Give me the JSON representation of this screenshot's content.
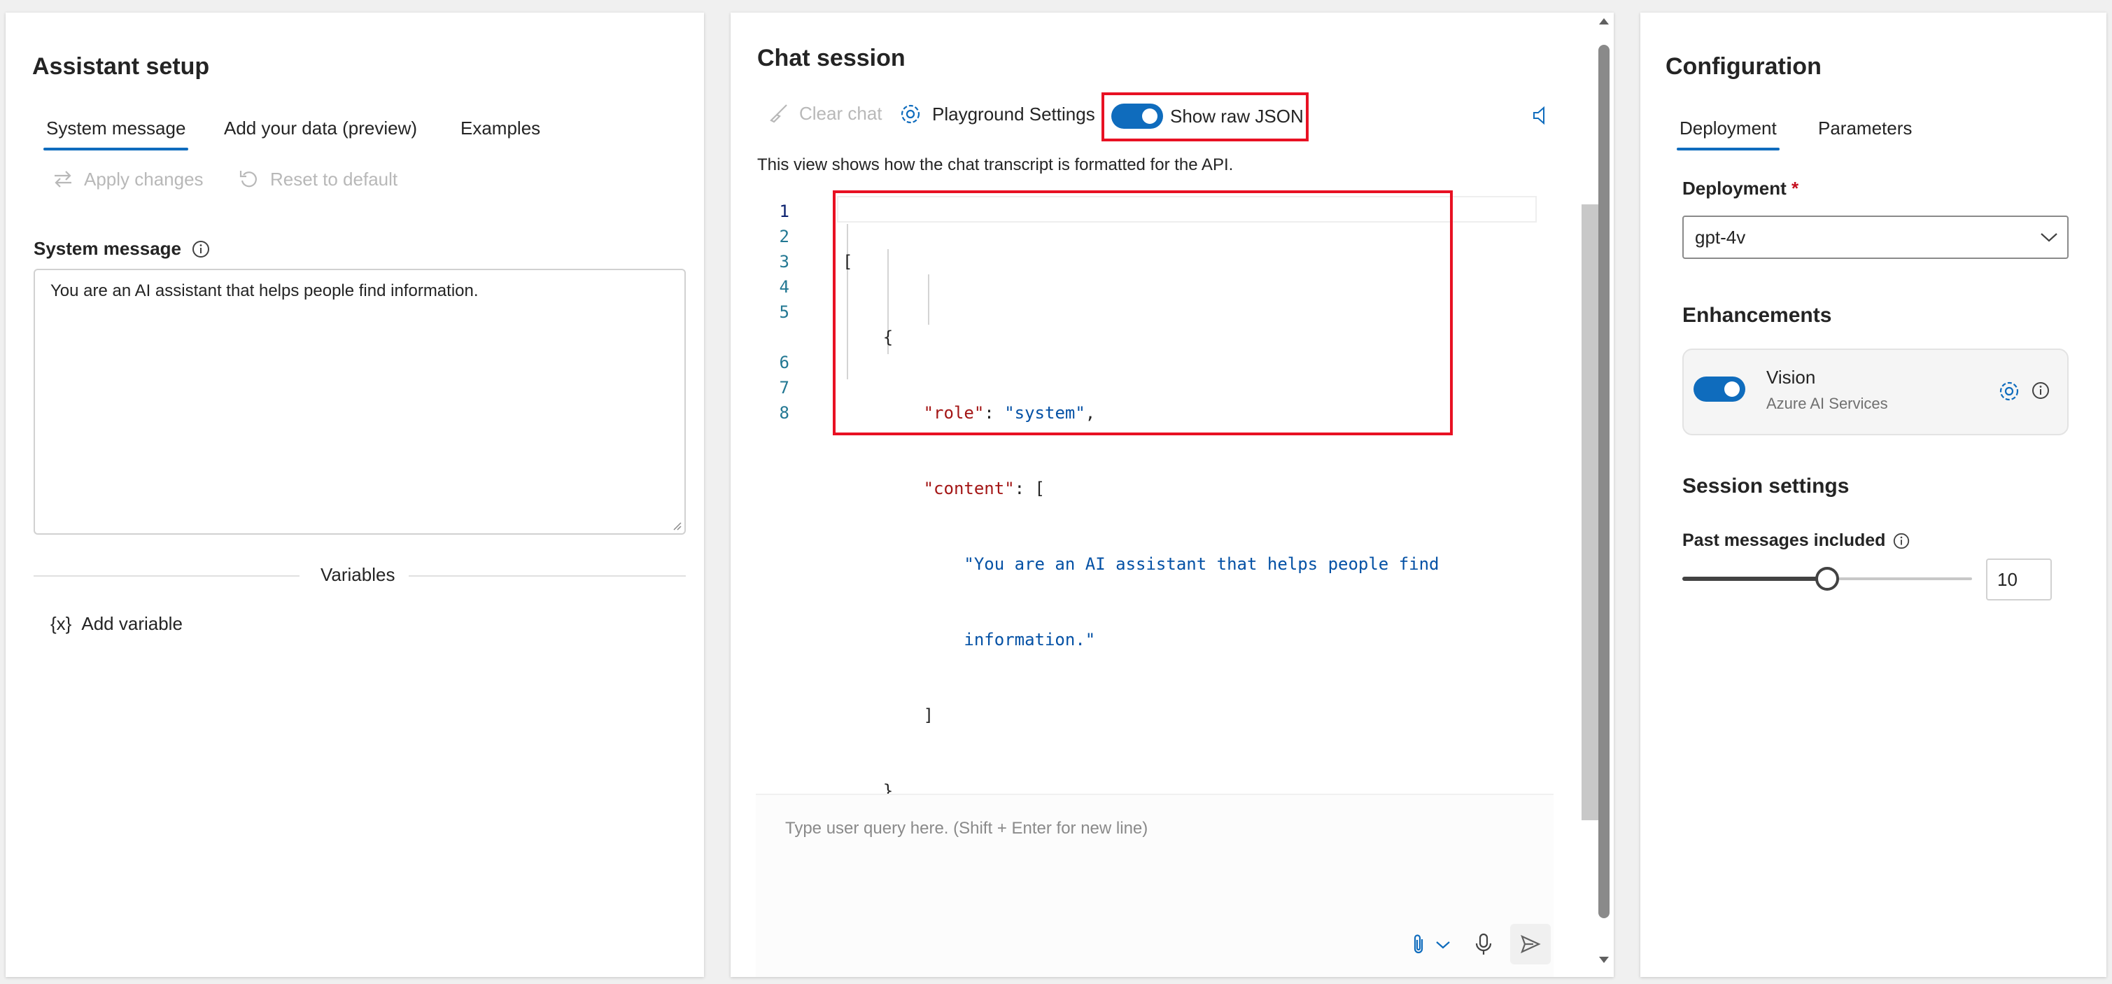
{
  "assistant_setup": {
    "title": "Assistant setup",
    "tabs": [
      {
        "label": "System message"
      },
      {
        "label": "Add your data (preview)"
      },
      {
        "label": "Examples"
      }
    ],
    "apply_changes_label": "Apply changes",
    "reset_label": "Reset to default",
    "system_message_label": "System message",
    "system_message_value": "You are an AI assistant that helps people find information.",
    "variables_label": "Variables",
    "add_variable_label": "Add variable",
    "add_variable_glyph": "{x}"
  },
  "chat_session": {
    "title": "Chat session",
    "clear_chat_label": "Clear chat",
    "playground_settings_label": "Playground Settings",
    "show_raw_json_label": "Show raw JSON",
    "show_raw_json_on": true,
    "description": "This view shows how the chat transcript is formatted for the API.",
    "line_numbers": [
      "1",
      "2",
      "3",
      "4",
      "5",
      "6",
      "7",
      "8"
    ],
    "code": {
      "open_bracket": "[",
      "open_brace": "{",
      "role_key": "\"role\"",
      "role_value": "\"system\"",
      "content_key": "\"content\"",
      "content_open": "[",
      "content_value_line1": "\"You are an AI assistant that helps people find",
      "content_value_line2": "information.\"",
      "content_close": "]",
      "close_brace": "}",
      "close_bracket": "]"
    },
    "input_placeholder": "Type user query here. (Shift + Enter for new line)",
    "icons": {
      "clear": "broom-icon",
      "settings": "gear-icon",
      "speaker": "speaker-icon",
      "attach": "paperclip-icon",
      "mic": "microphone-icon",
      "send": "send-icon"
    }
  },
  "configuration": {
    "title": "Configuration",
    "tabs": [
      {
        "label": "Deployment"
      },
      {
        "label": "Parameters"
      }
    ],
    "deployment_label": "Deployment",
    "required_marker": "*",
    "deployment_value": "gpt-4v",
    "enhancements_title": "Enhancements",
    "vision_label": "Vision",
    "vision_sublabel": "Azure AI Services",
    "vision_on": true,
    "session_settings_title": "Session settings",
    "past_messages_label": "Past messages included",
    "past_messages_value": "10",
    "past_messages_fraction": 0.5
  },
  "colors": {
    "accent": "#0f6cbd",
    "highlight_box": "#e81123",
    "json_key": "#a31515",
    "json_string": "#0451a5"
  }
}
